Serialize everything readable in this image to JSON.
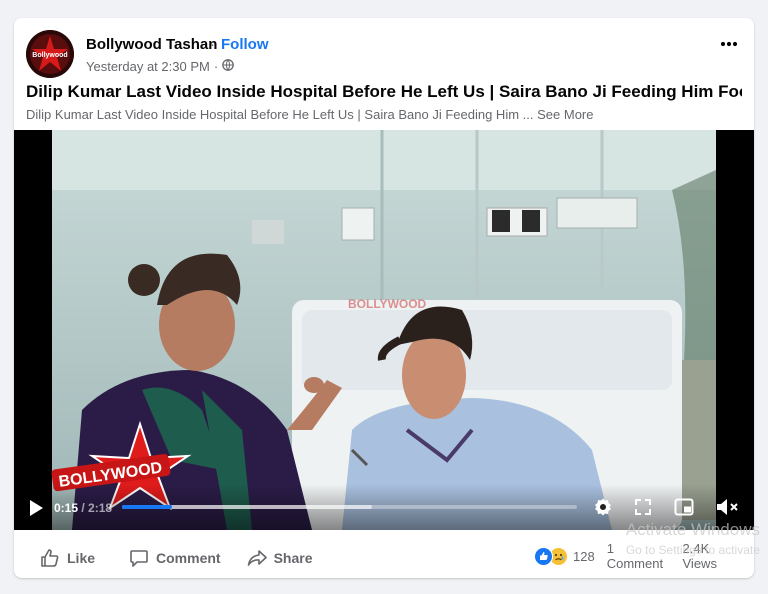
{
  "post": {
    "page_name": "Bollywood Tashan",
    "separator": "·",
    "follow_label": "Follow",
    "timestamp": "Yesterday at 2:30 PM",
    "meta_dot": "·",
    "title": "Dilip Kumar Last Video Inside Hospital Before He Left Us | Saira Bano Ji Feeding Him Food",
    "description": "Dilip Kumar Last Video Inside Hospital Before He Left Us | Saira Bano Ji Feeding Him ...",
    "see_more": "See More",
    "avatar_text": "Bollywood"
  },
  "video": {
    "current_time": "0:15",
    "total_time": "/ 2:18",
    "progress": 0.11,
    "buffered": 0.55,
    "logo_text": "BOLLYWOOD",
    "overlay_text": "BOLLYWOOD"
  },
  "stats": {
    "reaction_count": "128",
    "comments": "1 Comment",
    "views": "2.4K Views"
  },
  "actions": {
    "like": "Like",
    "comment": "Comment",
    "share": "Share"
  },
  "windows_watermark": {
    "line1": "Activate Windows",
    "line2": "Go to Settings to activate"
  },
  "colors": {
    "accent": "#1877f2",
    "text_primary": "#050505",
    "text_secondary": "#65676b"
  },
  "icons": [
    "globe-icon",
    "more-dots-icon",
    "play-icon",
    "settings-icon",
    "fullscreen-icon",
    "pip-icon",
    "mute-icon",
    "like-icon",
    "comment-icon",
    "share-icon"
  ]
}
